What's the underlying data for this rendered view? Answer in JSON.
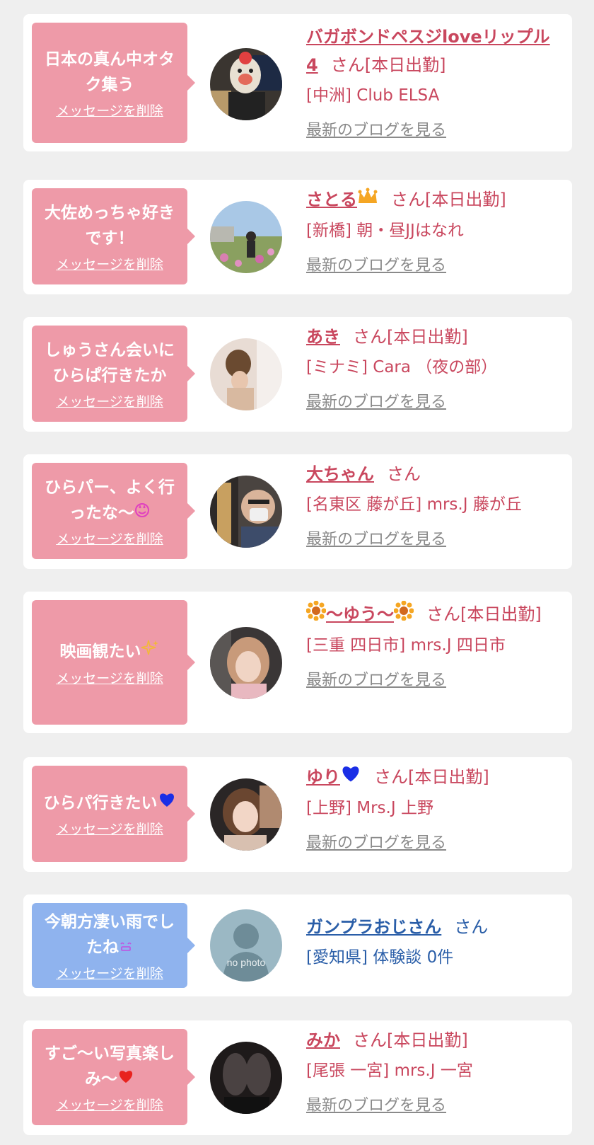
{
  "delete_label": "メッセージを削除",
  "blog_label": "最新のブログを見る",
  "cards": [
    {
      "message": "日本の真ん中オタク集う",
      "name": "バガボンドペスジloveリップル4",
      "suffix": "さん[本日出勤]",
      "shop": "[中洲] Club ELSA",
      "avatar": "mascot-mask-photo",
      "bubble_color": "#ee9aa8"
    },
    {
      "message": "大佐めっちゃ好きです！",
      "name": "さとる",
      "name_icon": "crown-icon",
      "suffix": "さん[本日出勤]",
      "shop": "[新橋] 朝・昼JJはなれ",
      "avatar": "flower-field-photo",
      "bubble_color": "#ee9aa8"
    },
    {
      "message": "しゅうさん会いにひらぱ行きたか",
      "name": "あき",
      "suffix": "さん[本日出勤]",
      "shop": "[ミナミ] Cara （夜の部）",
      "avatar": "updo-hair-photo",
      "bubble_color": "#ee9aa8"
    },
    {
      "message": "ひらパー、よく行ったな〜",
      "message_icon": "sparkle-eyes-face-icon",
      "name": "大ちゃん",
      "suffix": "さん",
      "shop": "[名東区 藤が丘] mrs.J 藤が丘",
      "avatar": "selfie-mask-photo",
      "bubble_color": "#ee9aa8"
    },
    {
      "message": "映画観たい",
      "message_icon": "sparkles-icon",
      "name": "〜ゆう〜",
      "name_icon": "sunflower-icon",
      "suffix": "さん[本日出勤]",
      "shop": "[三重 四日市] mrs.J 四日市",
      "avatar": "car-selfie-photo",
      "bubble_color": "#ee9aa8"
    },
    {
      "message": "ひらパ行きたい",
      "message_icon": "blue-heart-icon",
      "name": "ゆり",
      "name_icon": "blue-heart-icon",
      "suffix": "さん[本日出勤]",
      "shop": "[上野] Mrs.J 上野",
      "avatar": "smiling-woman-photo",
      "bubble_color": "#ee9aa8"
    },
    {
      "message": "今朝方凄い雨でしたね",
      "message_icon": "smile-face-icon",
      "name": "ガンプラおじさん",
      "suffix": "さん",
      "shop": "[愛知県] 体験談 0件",
      "avatar": "no-photo-placeholder",
      "avatar_text": "no photo",
      "bubble_color": "#8fb3ee"
    },
    {
      "message": "すご〜い写真楽しみ〜",
      "message_icon": "red-heart-icon",
      "name": "みか",
      "suffix": "さん[本日出勤]",
      "shop": "[尾張 一宮] mrs.J 一宮",
      "avatar": "legs-stockings-photo",
      "bubble_color": "#ee9aa8"
    }
  ]
}
